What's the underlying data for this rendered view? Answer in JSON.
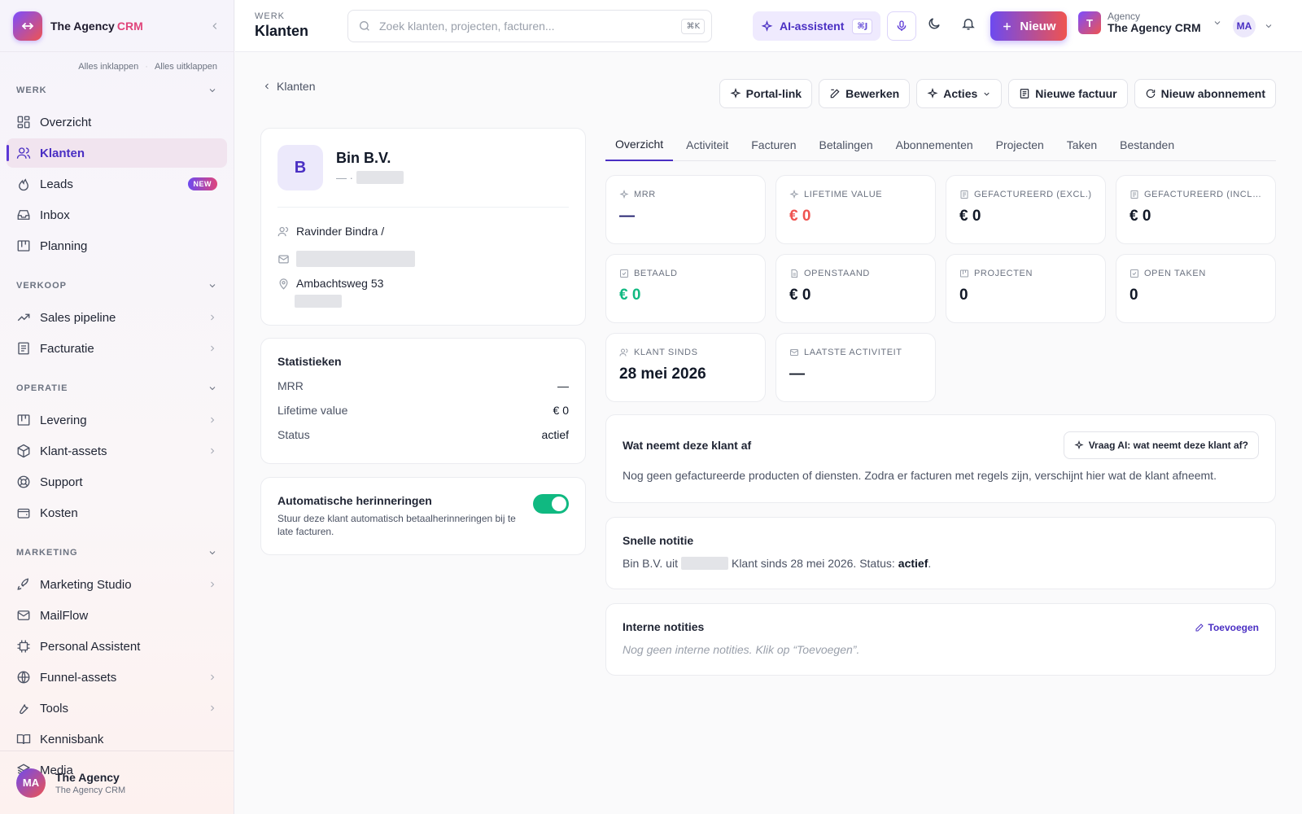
{
  "sidebar": {
    "brand": "The Agency",
    "brand_suffix": "CRM",
    "collapse_all": "Alles inklappen",
    "expand_all": "Alles uitklappen",
    "separator": "·",
    "sections": {
      "werk": "WERK",
      "verkoop": "VERKOOP",
      "operatie": "OPERATIE",
      "marketing": "MARKETING"
    },
    "items": {
      "overzicht": "Overzicht",
      "klanten": "Klanten",
      "leads": "Leads",
      "leads_badge": "NEW",
      "inbox": "Inbox",
      "planning": "Planning",
      "sales_pipeline": "Sales pipeline",
      "facturatie": "Facturatie",
      "levering": "Levering",
      "klant_assets": "Klant-assets",
      "support": "Support",
      "kosten": "Kosten",
      "marketing_studio": "Marketing Studio",
      "mailflow": "MailFlow",
      "personal_assistant": "Personal Assistent",
      "funnel_assets": "Funnel-assets",
      "tools": "Tools",
      "kennisbank": "Kennisbank",
      "media": "Media"
    },
    "footer": {
      "initials": "MA",
      "name": "The Agency",
      "sub": "The Agency CRM"
    }
  },
  "topbar": {
    "section": "WERK",
    "title": "Klanten",
    "search_placeholder": "Zoek klanten, projecten, facturen...",
    "search_kbd": "⌘K",
    "ai_label": "AI-assistent",
    "ai_kbd": "⌘J",
    "new_label": "Nieuw",
    "org_initial": "T",
    "org_label": "Agency",
    "org_name": "The Agency CRM",
    "user_initials": "MA"
  },
  "page": {
    "back_label": "Klanten",
    "actions": {
      "portal": "Portal-link",
      "edit": "Bewerken",
      "acties": "Acties",
      "new_invoice": "Nieuwe factuur",
      "new_subscription": "Nieuw abonnement"
    }
  },
  "client": {
    "initial": "B",
    "name": "Bin B.V.",
    "sub_prefix": "— ·",
    "contact": "Ravinder Bindra /",
    "address": "Ambachtsweg 53"
  },
  "stats": {
    "title": "Statistieken",
    "rows": [
      {
        "label": "MRR",
        "value": "—"
      },
      {
        "label": "Lifetime value",
        "value": "€ 0"
      },
      {
        "label": "Status",
        "value": "actief"
      }
    ]
  },
  "reminders": {
    "title": "Automatische herinneringen",
    "desc": "Stuur deze klant automatisch betaalherinneringen bij te late facturen.",
    "enabled": true
  },
  "tabs": [
    "Overzicht",
    "Activiteit",
    "Facturen",
    "Betalingen",
    "Abonnementen",
    "Projecten",
    "Taken",
    "Bestanden"
  ],
  "kpis": [
    {
      "label": "MRR",
      "value": "—",
      "icon": "sparkle-icon"
    },
    {
      "label": "LIFETIME VALUE",
      "value": "€ 0",
      "icon": "sparkle-icon"
    },
    {
      "label": "GEFACTUREERD (EXCL.)",
      "value": "€ 0",
      "icon": "document-icon"
    },
    {
      "label": "GEFACTUREERD (INCL. BTW)",
      "value": "€ 0",
      "icon": "document-icon"
    },
    {
      "label": "BETAALD",
      "value": "€ 0",
      "icon": "check-square-icon"
    },
    {
      "label": "OPENSTAAND",
      "value": "€ 0",
      "icon": "file-icon"
    },
    {
      "label": "PROJECTEN",
      "value": "0",
      "icon": "kanban-icon"
    },
    {
      "label": "OPEN TAKEN",
      "value": "0",
      "icon": "check-square-icon"
    },
    {
      "label": "KLANT SINDS",
      "value": "28 mei 2026",
      "icon": "users-icon"
    },
    {
      "label": "LAATSTE ACTIVITEIT",
      "value": "—",
      "icon": "mail-icon"
    }
  ],
  "colors": {
    "accent": "#4a2fc3",
    "mrr": "#1e1b6b",
    "lifetime": "#ef5350",
    "paid": "#10b981",
    "toggle_on": "#10b981"
  },
  "products": {
    "title": "Wat neemt deze klant af",
    "ask_ai": "Vraag AI: wat neemt deze klant af?",
    "empty": "Nog geen gefactureerde producten of diensten. Zodra er facturen met regels zijn, verschijnt hier wat de klant afneemt."
  },
  "quick_note": {
    "title": "Snelle notitie",
    "prefix": "Bin B.V. uit",
    "middle": "Klant sinds 28 mei 2026. Status:",
    "status": "actief",
    "suffix": "."
  },
  "internal_notes": {
    "title": "Interne notities",
    "add": "Toevoegen",
    "empty": "Nog geen interne notities. Klik op “Toevoegen”."
  }
}
